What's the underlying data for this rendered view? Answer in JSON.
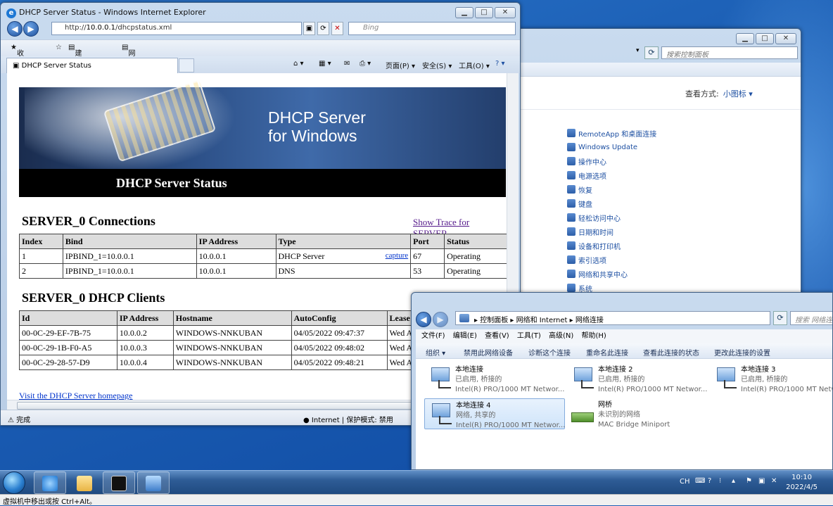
{
  "control_panel": {
    "search_placeholder": "搜索控制面板",
    "view_by_label": "查看方式:",
    "view_by_value": "小图标 ▾",
    "items": [
      "RemoteApp 和桌面连接",
      "Windows Update",
      "操作中心",
      "电源选项",
      "恢复",
      "键盘",
      "轻松访问中心",
      "日期和时间",
      "设备和打印机",
      "索引选项",
      "网络和共享中心",
      "系统"
    ]
  },
  "ie": {
    "title": "DHCP Server Status - Windows Internet Explorer",
    "address_prefix": "http://",
    "address_host": "10.0.0.1",
    "address_path": "/dhcpstatus.xml",
    "search_placeholder": "Bing",
    "favorites": "收藏夹",
    "suggested_sites": "建议网站 ▾",
    "web_slice": "网页快讯库 ▾",
    "tab_title": "DHCP Server Status",
    "cmd_page": "页面(P) ▾",
    "cmd_safety": "安全(S) ▾",
    "cmd_tools": "工具(O) ▾",
    "status_done": "完成",
    "status_zone": "Internet | 保护模式: 禁用"
  },
  "page": {
    "banner_line1": "DHCP Server",
    "banner_line2": "for Windows",
    "banner_title": "DHCP Server Status",
    "connections_title": "SERVER_0 Connections",
    "trace_link": "Show Trace for SERVER_",
    "connections_headers": [
      "Index",
      "Bind",
      "IP Address",
      "Type",
      "Port",
      "Status"
    ],
    "connections_rows": [
      {
        "index": "1",
        "bind": "IPBIND_1=10.0.0.1",
        "ip": "10.0.0.1",
        "type": "DHCP Server",
        "capture": "capture",
        "port": "67",
        "status": "Operating"
      },
      {
        "index": "2",
        "bind": "IPBIND_1=10.0.0.1",
        "ip": "10.0.0.1",
        "type": "DNS",
        "capture": "",
        "port": "53",
        "status": "Operating"
      }
    ],
    "clients_title": "SERVER_0 DHCP Clients",
    "clients_headers": [
      "Id",
      "IP Address",
      "Hostname",
      "AutoConfig",
      "Lease"
    ],
    "clients_rows": [
      {
        "id": "00-0C-29-EF-7B-75",
        "ip": "10.0.0.2",
        "host": "WINDOWS-NNKUBAN",
        "auto": "04/05/2022 09:47:37",
        "lease": "Wed A"
      },
      {
        "id": "00-0C-29-1B-F0-A5",
        "ip": "10.0.0.3",
        "host": "WINDOWS-NNKUBAN",
        "auto": "04/05/2022 09:48:02",
        "lease": "Wed A"
      },
      {
        "id": "00-0C-29-28-57-D9",
        "ip": "10.0.0.4",
        "host": "WINDOWS-NNKUBAN",
        "auto": "04/05/2022 09:48:21",
        "lease": "Wed A"
      }
    ],
    "homepage_link": "Visit the DHCP Server homepage"
  },
  "network": {
    "breadcrumb": "▸ 控制面板 ▸ 网络和 Internet ▸ 网络连接",
    "search_placeholder": "搜索 网络连",
    "menu": [
      "文件(F)",
      "编辑(E)",
      "查看(V)",
      "工具(T)",
      "高级(N)",
      "帮助(H)"
    ],
    "tools": [
      "组织 ▾",
      "禁用此网络设备",
      "诊断这个连接",
      "重命名此连接",
      "查看此连接的状态",
      "更改此连接的设置"
    ],
    "connections": [
      {
        "name": "本地连接",
        "status": "已启用, 桥接的",
        "device": "Intel(R) PRO/1000 MT Networ..."
      },
      {
        "name": "本地连接 2",
        "status": "已启用, 桥接的",
        "device": "Intel(R) PRO/1000 MT Networ..."
      },
      {
        "name": "本地连接 3",
        "status": "已启用, 桥接的",
        "device": "Intel(R) PRO/1000 MT Netw"
      },
      {
        "name": "本地连接 4",
        "status": "网络, 共享的",
        "device": "Intel(R) PRO/1000 MT Networ..."
      },
      {
        "name": "网桥",
        "status": "未识别的网络",
        "device": "MAC Bridge Miniport"
      }
    ]
  },
  "taskbar": {
    "lang": "CH",
    "time": "10:10",
    "date": "2022/4/5"
  },
  "vm_hint": "虚拟机中移出或按 Ctrl+Alt。"
}
